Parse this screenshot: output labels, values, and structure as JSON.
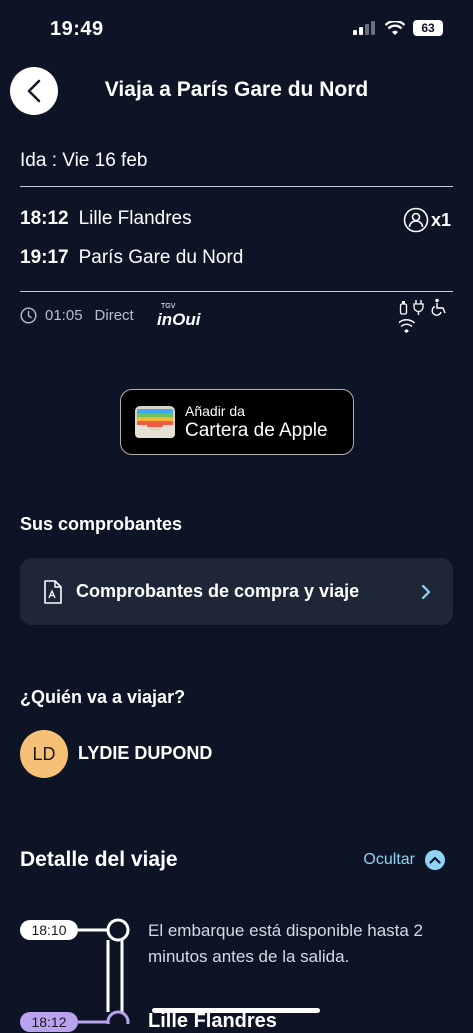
{
  "status_bar": {
    "time": "19:49",
    "battery": "63"
  },
  "header": {
    "title": "Viaja a París Gare du Nord"
  },
  "trip": {
    "ida_label": "Ida : Vie 16 feb",
    "departure_time": "18:12",
    "departure_station": "Lille Flandres",
    "arrival_time": "19:17",
    "arrival_station": "París Gare du Nord",
    "passenger_count": "x1",
    "duration": "01:05",
    "type": "Direct",
    "brand_small": "TGV",
    "brand": "inOui"
  },
  "wallet": {
    "line1": "Añadir da",
    "line2": "Cartera de Apple"
  },
  "receipts": {
    "section_title": "Sus comprobantes",
    "card_label": "Comprobantes de compra y viaje"
  },
  "travelers": {
    "section_title": "¿Quién va a viajar?",
    "initials": "LD",
    "name": "LYDIE DUPOND"
  },
  "details": {
    "section_title": "Detalle del viaje",
    "toggle_label": "Ocultar",
    "boarding_time": "18:10",
    "boarding_note": "El embarque está disponible hasta 2 minutos antes de la salida.",
    "departure_time": "18:12",
    "departure_station": "Lille Flandres"
  },
  "colors": {
    "background": "#0c1426",
    "card": "#1e2738",
    "accent": "#8fd3f5",
    "avatar": "#f6c177",
    "timeline_purple": "#b9a3ee"
  }
}
